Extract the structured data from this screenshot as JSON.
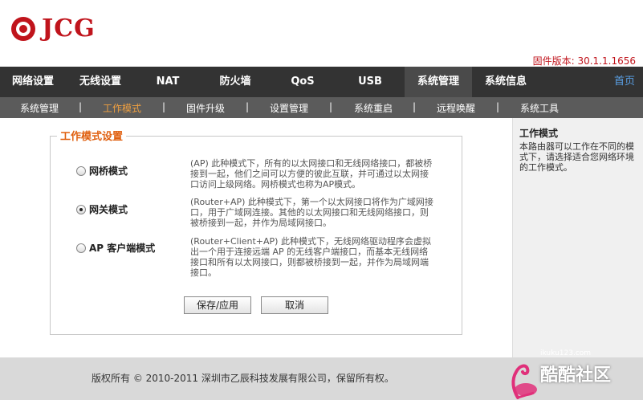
{
  "header": {
    "logo_text": "JCG",
    "firmware": "固件版本: 30.1.1.1656",
    "brand_color": "#c0141c"
  },
  "mainnav": {
    "items": [
      "网络设置",
      "无线设置",
      "NAT",
      "防火墙",
      "QoS",
      "USB",
      "系统管理",
      "系统信息"
    ],
    "active": "系统管理",
    "home": "首页"
  },
  "subnav": {
    "items": [
      "系统管理",
      "工作模式",
      "固件升级",
      "设置管理",
      "系统重启",
      "远程唤醒",
      "系统工具"
    ],
    "active": "工作模式",
    "separator": "|"
  },
  "form": {
    "legend": "工作模式设置",
    "modes": [
      {
        "name": "网桥模式",
        "checked": false,
        "desc": "(AP) 此种模式下，所有的以太网接口和无线网络接口，都被桥接到一起，他们之间可以方便的彼此互联，并可通过以太网接口访问上级网络。网桥模式也称为AP模式。"
      },
      {
        "name": "网关模式",
        "checked": true,
        "desc": "(Router+AP) 此种模式下，第一个以太网接口将作为广域网接口，用于广域网连接。其他的以太网接口和无线网络接口，则被桥接到一起，并作为局域网接口。"
      },
      {
        "name": "AP 客户端模式",
        "checked": false,
        "desc": "(Router+Client+AP) 此种模式下，无线网络驱动程序会虚拟出一个用于连接远端 AP 的无线客户端接口，而基本无线网络接口和所有以太网接口，则都被桥接到一起，并作为局域网端接口。"
      }
    ],
    "save_label": "保存/应用",
    "cancel_label": "取消"
  },
  "help": {
    "title": "工作模式",
    "text": "本路由器可以工作在不同的模式下，请选择适合您网络环境的工作模式。"
  },
  "footer": {
    "copyright": "版权所有 © 2010-2011 深圳市乙辰科技发展有限公司，保留所有权。",
    "watermark_site": "ikuku123.com",
    "watermark_text": "酷酷社区"
  }
}
